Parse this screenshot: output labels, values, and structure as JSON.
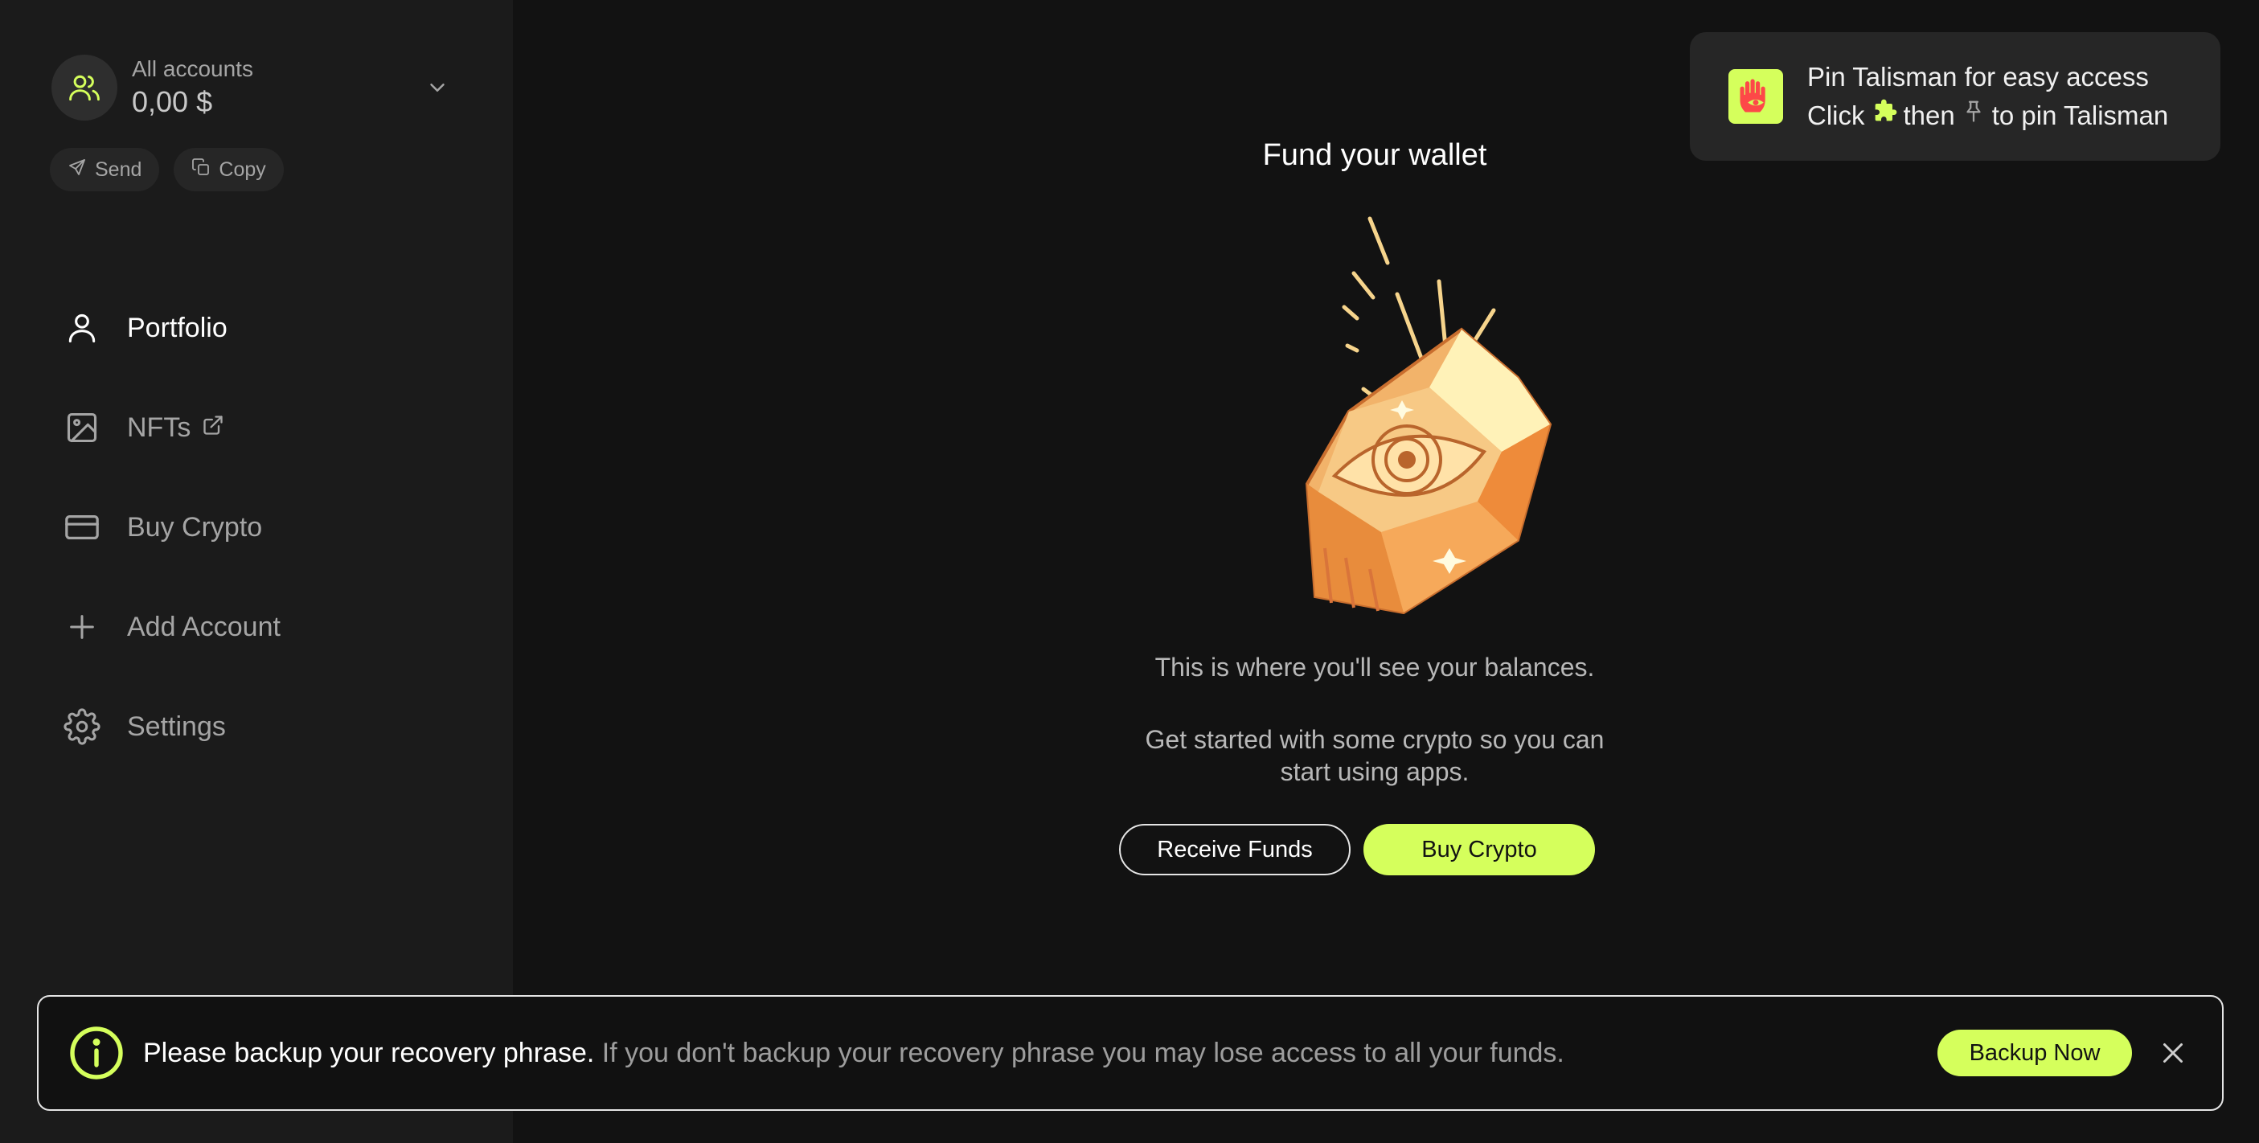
{
  "account": {
    "label": "All accounts",
    "balance": "0,00 $",
    "avatar_icon": "users-icon",
    "chevron_icon": "chevron-down-icon"
  },
  "quick_actions": [
    {
      "label": "Send",
      "icon": "send-icon"
    },
    {
      "label": "Copy",
      "icon": "copy-icon"
    }
  ],
  "nav": {
    "items": [
      {
        "label": "Portfolio",
        "icon": "user-icon",
        "active": true
      },
      {
        "label": "NFTs",
        "icon": "image-icon",
        "external_icon": "external-link-icon"
      },
      {
        "label": "Buy Crypto",
        "icon": "credit-card-icon"
      },
      {
        "label": "Add Account",
        "icon": "plus-icon"
      },
      {
        "label": "Settings",
        "icon": "gear-icon"
      }
    ]
  },
  "main": {
    "title": "Fund your wallet",
    "description": "This is where you'll see your balances.",
    "subdescription": "Get started with some crypto so you can start using apps.",
    "receive_label": "Receive Funds",
    "buy_label": "Buy Crypto"
  },
  "toast": {
    "title": "Pin Talisman for easy access",
    "line2_prefix": "Click",
    "line2_middle": "then",
    "line2_suffix": "to pin Talisman",
    "logo_icon": "talisman-logo-icon",
    "puzzle_icon": "puzzle-icon",
    "pin_icon": "pin-icon"
  },
  "banner": {
    "strong": "Please backup your recovery phrase.",
    "text": "If you don't backup your recovery phrase you may lose access to all your funds.",
    "button_label": "Backup Now",
    "info_icon": "info-icon",
    "close_icon": "close-icon"
  },
  "colors": {
    "accent": "#d5ff5c",
    "background": "#121212",
    "sidebar": "#1b1b1b"
  }
}
